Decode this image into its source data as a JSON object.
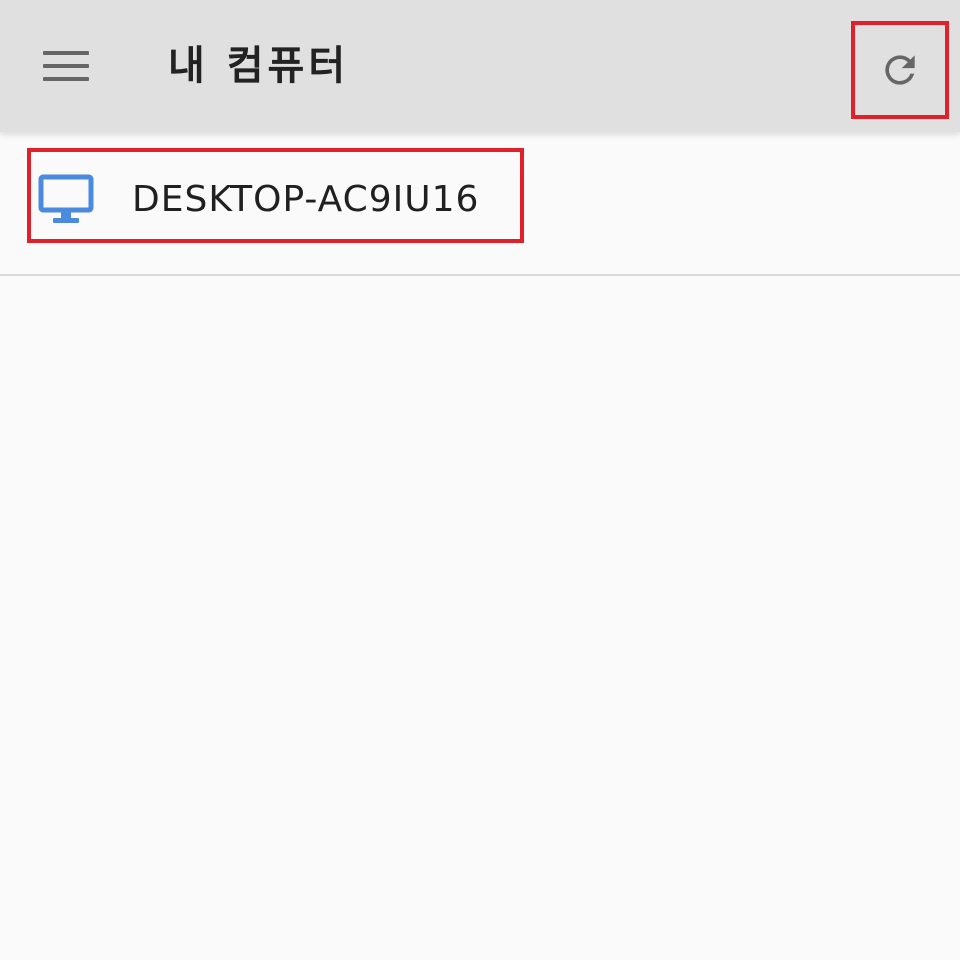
{
  "toolbar": {
    "title": "내 컴퓨터",
    "menu_icon": "hamburger-menu-icon",
    "refresh_icon": "refresh-icon",
    "background_color": "#e0e0e0",
    "highlight_color": "#e0202a"
  },
  "computers": [
    {
      "name": "DESKTOP-AC9IU16",
      "icon": "desktop-monitor-icon",
      "icon_color": "#4a8be0"
    }
  ]
}
